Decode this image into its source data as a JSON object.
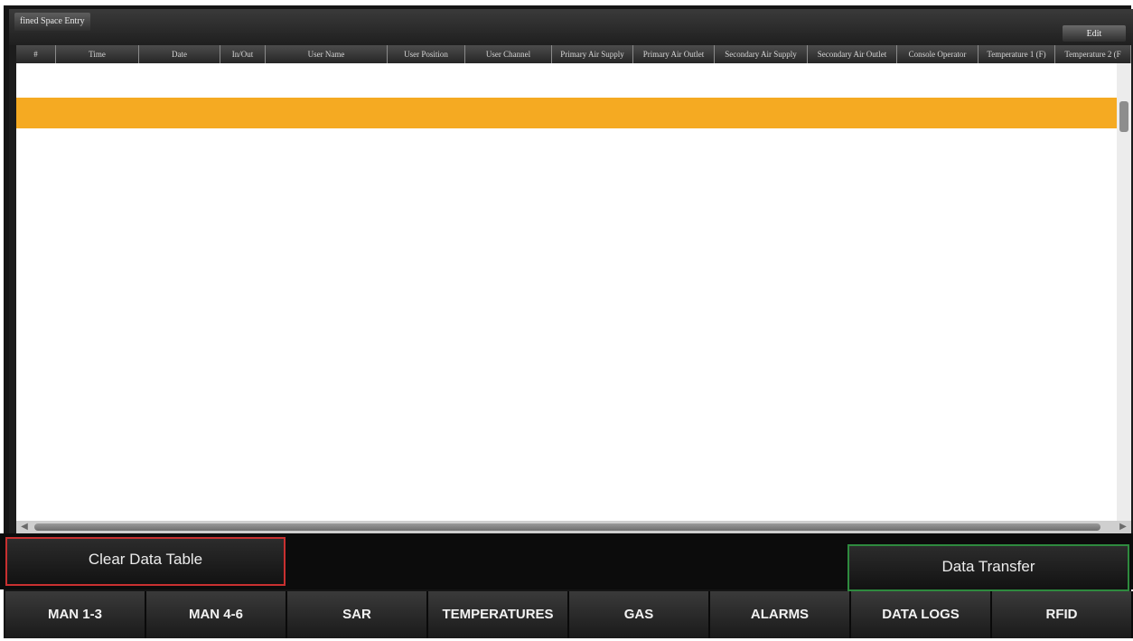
{
  "window": {
    "title": "fined Space Entry",
    "edit_label": "Edit"
  },
  "table": {
    "columns": [
      "#",
      "Time",
      "Date",
      "In/Out",
      "User Name",
      "User Position",
      "User Channel",
      "Primary Air Supply",
      "Primary Air Outlet",
      "Secondary Air Supply",
      "Secondary Air Outlet",
      "Console Operator",
      "Temperature 1 (F)",
      "Temperature 2 (F"
    ]
  },
  "actions": {
    "clear_label": "Clear Data Table",
    "transfer_label": "Data Transfer"
  },
  "nav": {
    "tabs": [
      "MAN 1-3",
      "MAN 4-6",
      "SAR",
      "TEMPERATURES",
      "GAS",
      "ALARMS",
      "DATA LOGS",
      "RFID"
    ]
  },
  "colors": {
    "selected_row": "#f5aa22",
    "clear_border": "#c83030",
    "transfer_border": "#2e8a3e"
  }
}
